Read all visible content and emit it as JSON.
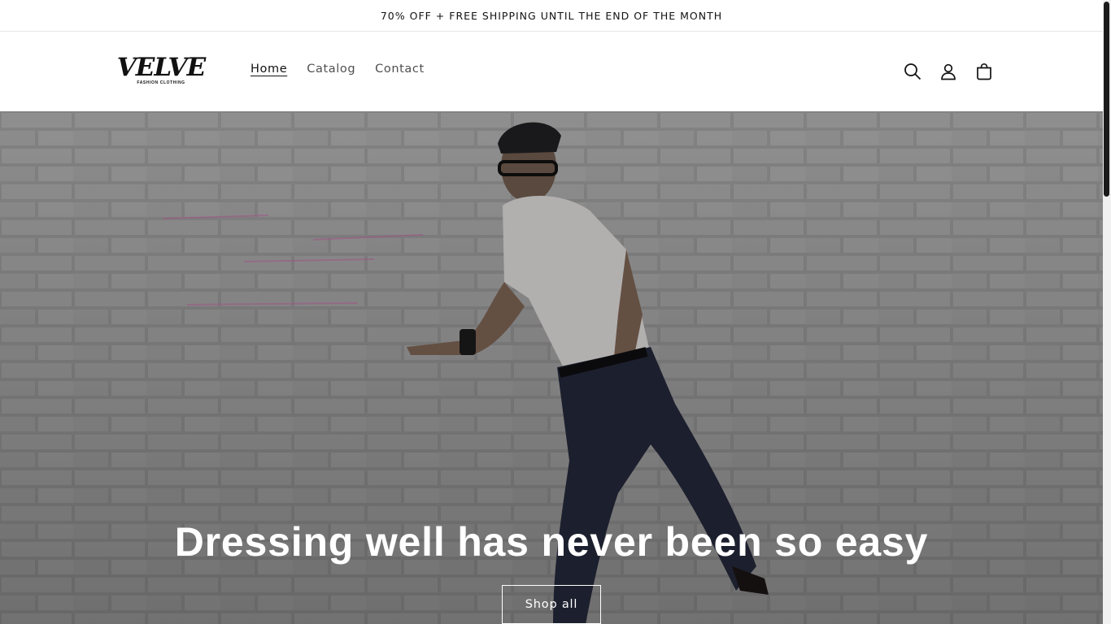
{
  "announcement": {
    "text": "70% OFF + FREE SHIPPING UNTIL THE END OF THE MONTH"
  },
  "header": {
    "logo": {
      "word": "VELVE",
      "tagline": "FASHION CLOTHING"
    },
    "nav": [
      {
        "label": "Home",
        "active": true
      },
      {
        "label": "Catalog",
        "active": false
      },
      {
        "label": "Contact",
        "active": false
      }
    ],
    "icons": [
      "search-icon",
      "account-icon",
      "cart-icon"
    ]
  },
  "hero": {
    "title": "Dressing well has never been so easy",
    "button_label": "Shop all"
  },
  "colors": {
    "text": "#121212",
    "hero_text": "#ffffff",
    "wall": "#8f8e8f"
  }
}
